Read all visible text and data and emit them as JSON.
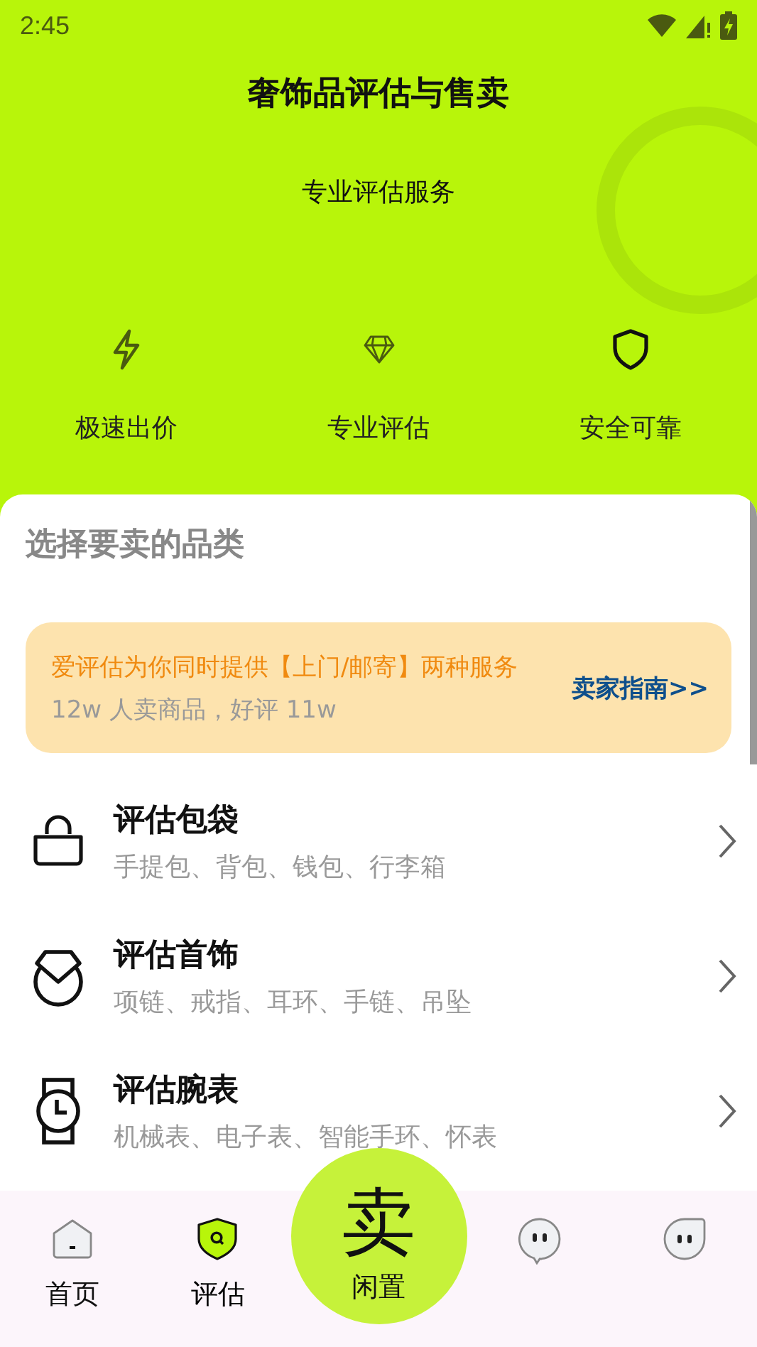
{
  "status_bar": {
    "time": "2:45"
  },
  "header": {
    "title": "奢饰品评估与售卖",
    "subtitle": "专业评估服务"
  },
  "features": [
    {
      "kind": "bolt",
      "label": "极速出价"
    },
    {
      "kind": "diamond",
      "label": "专业评估"
    },
    {
      "kind": "shield",
      "label": "安全可靠"
    }
  ],
  "sheet": {
    "heading": "选择要卖的品类",
    "banner": {
      "headline": "爱评估为你同时提供【上门/邮寄】两种服务",
      "stats": "12w 人卖商品，好评 11w",
      "link": "卖家指南>>"
    },
    "categories": [
      {
        "kind": "bag",
        "title": "评估包袋",
        "items": "手提包、背包、钱包、行李箱"
      },
      {
        "kind": "jewelry",
        "title": "评估首饰",
        "items": "项链、戒指、耳环、手链、吊坠"
      },
      {
        "kind": "watch",
        "title": "评估腕表",
        "items": "机械表、电子表、智能手环、怀表"
      }
    ]
  },
  "bottom_nav": {
    "items": [
      {
        "kind": "home",
        "label": "首页",
        "selected": false
      },
      {
        "kind": "eval",
        "label": "评估",
        "selected": true
      },
      {
        "kind": "sell",
        "label": "卖",
        "sublabel": "闲置",
        "selected": false
      },
      {
        "kind": "chat",
        "selected": false
      },
      {
        "kind": "profile",
        "selected": false
      }
    ]
  }
}
